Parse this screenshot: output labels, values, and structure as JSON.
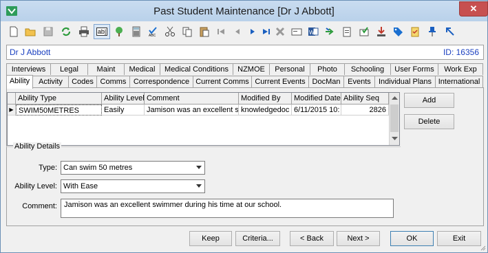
{
  "window": {
    "title": "Past Student Maintenance  [Dr J Abbott]",
    "close_glyph": "✕"
  },
  "toolbar": {
    "icons": [
      "new-icon",
      "open-icon",
      "save-icon",
      "refresh-icon",
      "print-icon",
      "text-field-icon",
      "tree-icon",
      "calculator-icon",
      "spellcheck-icon",
      "cut-icon",
      "copy-icon",
      "paste-icon",
      "first-record-icon",
      "previous-record-icon",
      "play-icon",
      "last-record-icon",
      "delete-icon",
      "card-icon",
      "word-icon",
      "arrow-icon",
      "clipboard-icon",
      "mail-icon",
      "download-icon",
      "tag-icon",
      "checklist-icon",
      "pin-icon",
      "arrow-up-left-icon"
    ],
    "text_field_label": "ab|"
  },
  "record": {
    "name": "Dr J Abbott",
    "id_label": "ID: 16356"
  },
  "tabs_row1": [
    "Interviews",
    "Legal",
    "Maint",
    "Medical",
    "Medical Conditions",
    "NZMOE",
    "Personal",
    "Photo",
    "Schooling",
    "User Forms",
    "Work Exp"
  ],
  "tabs_row2": [
    "Ability",
    "Activity",
    "Codes",
    "Comms",
    "Correspondence",
    "Current Comms",
    "Current Events",
    "DocMan",
    "Events",
    "Individual Plans",
    "International"
  ],
  "active_tab": "Ability",
  "grid": {
    "headers": [
      "Ability Type",
      "Ability Level",
      "Comment",
      "Modified By",
      "Modified Date",
      "Ability Seq"
    ],
    "rows": [
      [
        "SWIM50METRES",
        "Easily",
        "Jamison was an excellent sw",
        "knowledgedoc",
        "6/11/2015 10:",
        "2826"
      ]
    ],
    "row_indicator": "▶"
  },
  "side_buttons": {
    "add": "Add",
    "delete": "Delete"
  },
  "details": {
    "legend": "Ability Details",
    "type_label": "Type:",
    "type_value": "Can swim 50 metres",
    "level_label": "Ability Level:",
    "level_value": "With Ease",
    "comment_label": "Comment:",
    "comment_value": "Jamison was an excellent swimmer during his time at our school."
  },
  "footer": {
    "keep": "Keep",
    "criteria": "Criteria...",
    "back": "< Back",
    "next": "Next >",
    "ok": "OK",
    "exit": "Exit"
  }
}
